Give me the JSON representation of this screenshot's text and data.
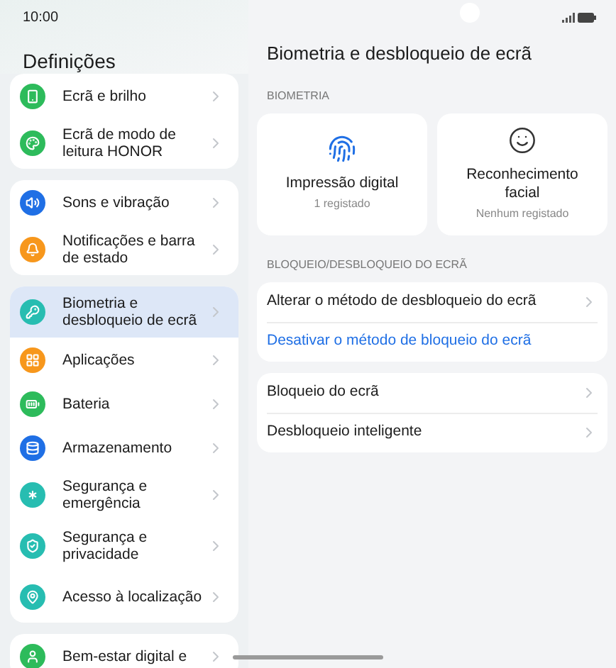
{
  "status_bar": {
    "time": "10:00"
  },
  "sidebar": {
    "title": "Definições",
    "groups": [
      {
        "items": [
          {
            "label": "Ecrã e brilho",
            "color": "#2dbb5b",
            "selected": false
          },
          {
            "label": "Ecrã de modo de leitura HONOR",
            "color": "#2dbb5b",
            "selected": false
          }
        ]
      },
      {
        "items": [
          {
            "label": "Sons e vibração",
            "color": "#1f6fe5",
            "selected": false
          },
          {
            "label": "Notificações e barra de estado",
            "color": "#f7971c",
            "selected": false
          }
        ]
      },
      {
        "items": [
          {
            "label": "Biometria e desbloqueio de ecrã",
            "color": "#27bdb1",
            "selected": true
          },
          {
            "label": "Aplicações",
            "color": "#f7971c",
            "selected": false
          },
          {
            "label": "Bateria",
            "color": "#2dbb5b",
            "selected": false
          },
          {
            "label": "Armazenamento",
            "color": "#1f6fe5",
            "selected": false
          },
          {
            "label": "Segurança e emergência",
            "color": "#27bdb1",
            "selected": false
          },
          {
            "label": "Segurança e privacidade",
            "color": "#27bdb1",
            "selected": false
          },
          {
            "label": "Acesso à localização",
            "color": "#27bdb1",
            "selected": false
          }
        ]
      },
      {
        "items": [
          {
            "label": "Bem-estar digital e",
            "color": "#2dbb5b",
            "selected": false
          }
        ]
      }
    ]
  },
  "page": {
    "title": "Biometria e desbloqueio de ecrã",
    "biometrics": {
      "label": "BIOMETRIA",
      "cards": [
        {
          "title": "Impressão digital",
          "subtitle": "1 registado"
        },
        {
          "title": "Reconhecimento facial",
          "subtitle": "Nenhum registado"
        }
      ]
    },
    "lock": {
      "label": "BLOQUEIO/DESBLOQUEIO DO ECRÃ",
      "groups": [
        {
          "rows": [
            {
              "kind": "nav",
              "label": "Alterar o método de desbloqueio do ecrã"
            },
            {
              "kind": "link",
              "label": "Desativar o método de bloqueio do ecrã"
            }
          ]
        },
        {
          "rows": [
            {
              "kind": "nav",
              "label": "Bloqueio do ecrã"
            },
            {
              "kind": "nav",
              "label": "Desbloqueio inteligente"
            }
          ]
        }
      ]
    }
  }
}
